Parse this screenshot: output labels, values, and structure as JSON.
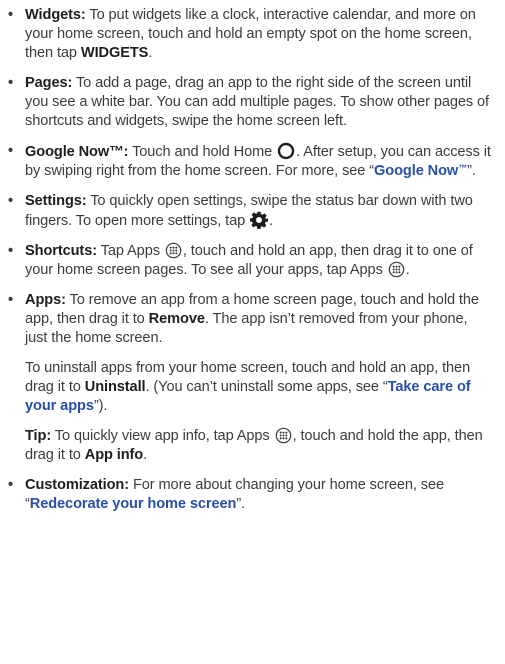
{
  "items": [
    {
      "label": "Widgets:",
      "text1": " To put widgets like a clock, interactive calendar, and more on your home screen, touch and hold an empty spot on the home screen, then tap ",
      "strong": "WIDGETS",
      "text2": "."
    },
    {
      "label": "Pages:",
      "text1": " To add a page, drag an app to the right side of the screen until you see a white bar. You can add multiple pages. To show other pages of shortcuts and widgets, swipe the home screen left."
    },
    {
      "label": "Google Now™:",
      "text1": " Touch and hold Home ",
      "text2": ". After setup, you can access it by swiping right from the home screen. For more, see “",
      "link": "Google Now",
      "tm": "™",
      "text3": "”."
    },
    {
      "label": "Settings:",
      "text1": " To quickly open settings, swipe the status bar down with two fingers. To open more settings, tap ",
      "text2": "."
    },
    {
      "label": "Shortcuts:",
      "text1": " Tap Apps ",
      "text2": ", touch and hold an app, then drag it to one of your home screen pages. To see all your apps, tap Apps ",
      "text3": "."
    },
    {
      "label": "Apps:",
      "text1": " To remove an app from a home screen page, touch and hold the app, then drag it to ",
      "strong": "Remove",
      "text2": ". The app isn’t removed from your phone, just the home screen."
    },
    {
      "label": "Customization:",
      "text1": " For more about changing your home screen, see “",
      "link": "Redecorate your home screen",
      "text2": "”."
    }
  ],
  "uninstall": {
    "text1": "To uninstall apps from your home screen, touch and hold an app, then drag it to ",
    "strong": "Uninstall",
    "text2": ". (You can’t uninstall some apps, see “",
    "link": "Take care of your apps",
    "text3": "”)."
  },
  "tip": {
    "label": "Tip:",
    "text1": " To quickly view app info, tap Apps ",
    "text2": ", touch and hold the app, then drag it to ",
    "strong": "App info",
    "text3": "."
  },
  "bullet": "•",
  "icons": {
    "home": "home-circle-icon",
    "settings": "gear-icon",
    "apps": "apps-grid-icon"
  },
  "colors": {
    "text": "#3c3c3c",
    "link": "#2a4fa8"
  }
}
